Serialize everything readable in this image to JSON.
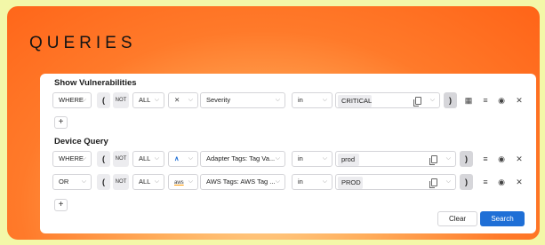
{
  "page": {
    "title": "QUERIES"
  },
  "colors": {
    "accent": "#1f6fd6",
    "frame": "#ff7a2a"
  },
  "queries": [
    {
      "title": "Show Vulnerabilities",
      "rows": [
        {
          "connector": "WHERE",
          "open_paren": "(",
          "not": "NOT",
          "scope": "ALL",
          "adapter_icon": "crossed-arrows-icon",
          "field": "Severity",
          "operator": "in",
          "value": "CRITICAL",
          "close_paren": ")"
        }
      ],
      "add_label": "+"
    },
    {
      "title": "Device Query",
      "rows": [
        {
          "connector": "WHERE",
          "open_paren": "(",
          "not": "NOT",
          "scope": "ALL",
          "adapter_icon": "chevron-up-icon",
          "field": "Adapter Tags: Tag Va...",
          "operator": "in",
          "value": "prod",
          "close_paren": ")"
        },
        {
          "connector": "OR",
          "open_paren": "(",
          "not": "NOT",
          "scope": "ALL",
          "adapter_icon": "aws-icon",
          "adapter_text": "aws",
          "field": "AWS Tags: AWS Tag ...",
          "operator": "in",
          "value": "PROD",
          "close_paren": ")"
        }
      ],
      "add_label": "+"
    }
  ],
  "footer": {
    "clear_label": "Clear",
    "search_label": "Search"
  }
}
